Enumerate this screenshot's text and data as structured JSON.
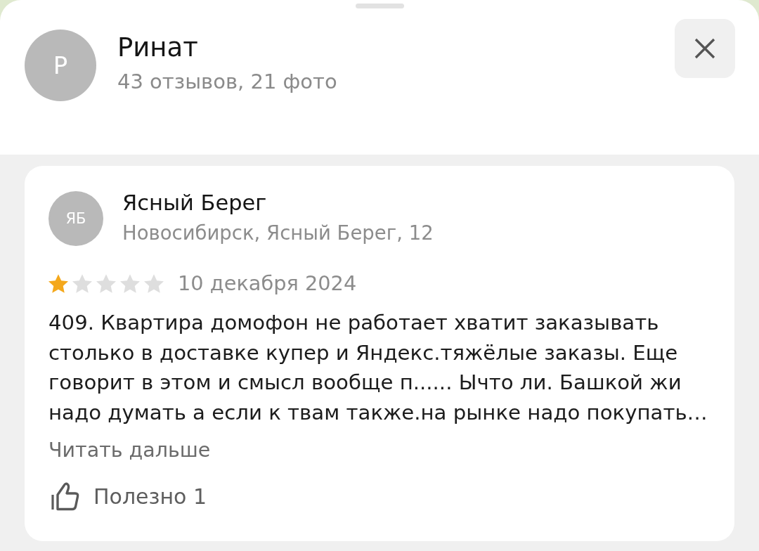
{
  "profile": {
    "avatar_letter": "Р",
    "name": "Ринат",
    "stats": "43 отзывов, 21 фото"
  },
  "review": {
    "org_avatar": "ЯБ",
    "org_name": "Ясный Берег",
    "address": "Новосибирск, Ясный Берег, 12",
    "stars": 1,
    "date": "10 декабря 2024",
    "text": "409. Квартира домофон не работает хватит заказывать столько в доставке купер и Яндекс.тяжёлые заказы. Еще говорит в этом и смысл вообще п...... Ычто ли. Башкой жи надо думать а если к твам также.на рынке надо покупать…",
    "read_more": "Читать дальше",
    "useful": "Полезно 1"
  }
}
